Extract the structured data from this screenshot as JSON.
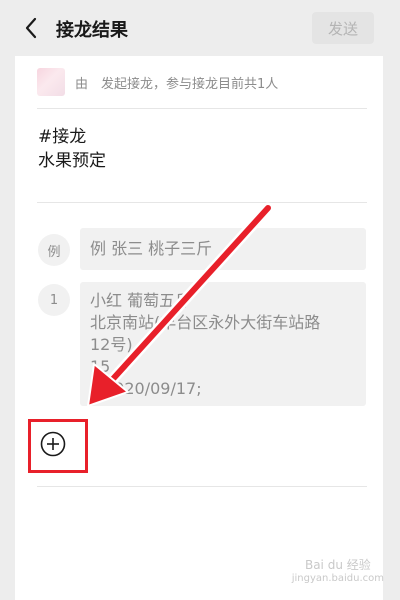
{
  "header": {
    "title": "接龙结果",
    "send_label": "发送"
  },
  "info": {
    "by_label": "由",
    "summary": "发起接龙，参与接龙目前共1人"
  },
  "content": {
    "topic": "#接龙",
    "title": "水果预定"
  },
  "example": {
    "badge": "例",
    "text": "例 张三 桃子三斤"
  },
  "entries": [
    {
      "badge": "1",
      "line1": "小红 葡萄五斤",
      "line2": "北京南站(丰台区永外大街车站路",
      "line3": "12号)",
      "line4": "15",
      "line5": "2020/09/17;"
    }
  ],
  "watermark": {
    "line1": "Bai du 经验",
    "line2": "jingyan.baidu.com"
  },
  "colors": {
    "accent_red": "#e8202a",
    "card_bg": "#ffffff",
    "page_bg": "#ededed"
  }
}
